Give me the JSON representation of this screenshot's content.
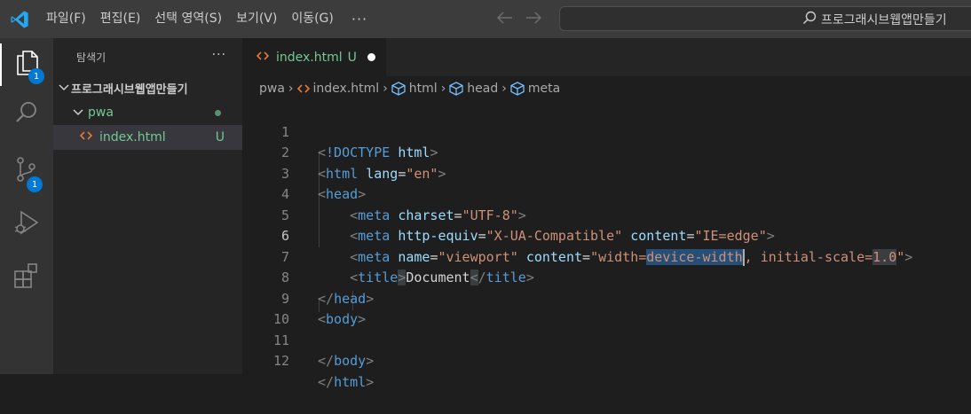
{
  "titlebar": {
    "menu": [
      "파일(F)",
      "편집(E)",
      "선택 영역(S)",
      "보기(V)",
      "이동(G)"
    ],
    "more": "···",
    "back_icon": "arrow-left-icon",
    "forward_icon": "arrow-right-icon",
    "search_text": "프로그래시브웹앱만들기"
  },
  "activitybar": {
    "explorer_badge": "1",
    "scm_badge": "1",
    "icons": [
      "files-icon",
      "search-icon",
      "source-control-icon",
      "run-debug-icon",
      "extensions-icon"
    ],
    "accent_color": "#0078d4"
  },
  "sidebar": {
    "title": "탐색기",
    "more": "···",
    "root_folder": "프로그래시브웹앱만들기",
    "folder": "pwa",
    "file": "index.html",
    "file_status": "U"
  },
  "editor": {
    "tab_name": "index.html",
    "tab_status": "U",
    "breadcrumb": [
      "pwa",
      "index.html",
      "html",
      "head",
      "meta"
    ],
    "current_line": 6
  },
  "code_lines": [
    {
      "n": "1"
    },
    {
      "n": "2"
    },
    {
      "n": "3"
    },
    {
      "n": "4"
    },
    {
      "n": "5"
    },
    {
      "n": "6"
    },
    {
      "n": "7"
    },
    {
      "n": "8"
    },
    {
      "n": "9"
    },
    {
      "n": "10"
    },
    {
      "n": "11"
    },
    {
      "n": "12"
    }
  ],
  "code": {
    "doctype_kw": "!DOCTYPE",
    "html": "html",
    "head": "head",
    "meta": "meta",
    "title": "title",
    "body": "body",
    "lang_attr": "lang",
    "lang_val": "\"en\"",
    "charset_attr": "charset",
    "charset_val": "\"UTF-8\"",
    "http_equiv_attr": "http-equiv",
    "http_equiv_val": "\"X-UA-Compatible\"",
    "content_attr": "content",
    "content_val_1": "\"IE=edge\"",
    "name_attr": "name",
    "name_val": "\"viewport\"",
    "viewport_pre": "\"width=",
    "viewport_sel": "device-width",
    "viewport_post": ", initial-scale=",
    "viewport_num": "1.0",
    "viewport_end": "\"",
    "title_text": "Document"
  }
}
